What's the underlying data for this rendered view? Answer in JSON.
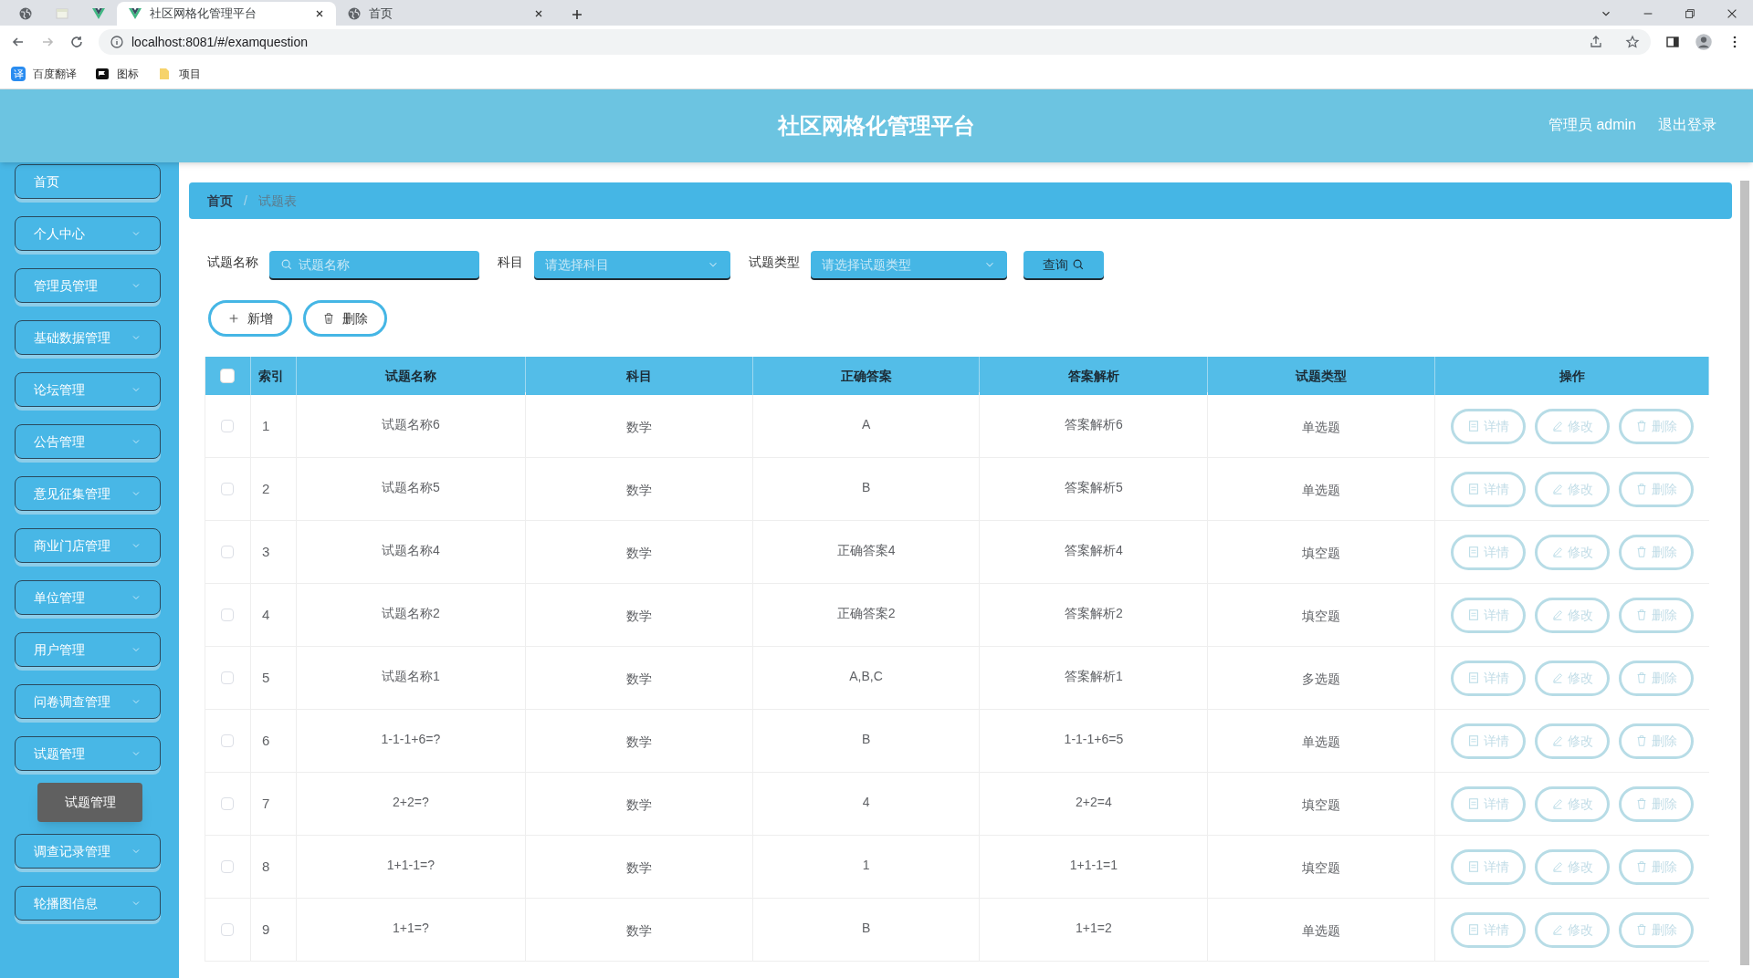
{
  "browser": {
    "tabs": [
      {
        "kind": "globe",
        "selected": false
      },
      {
        "kind": "page",
        "selected": false
      },
      {
        "kind": "vue",
        "selected": false
      },
      {
        "kind": "vue",
        "title": "社区网格化管理平台",
        "selected": true
      },
      {
        "kind": "globe",
        "title": "首页",
        "selected": false
      }
    ],
    "address": "localhost:8081/#/examquestion",
    "bookmarks": [
      {
        "kind": "translate",
        "badge": "译",
        "label": "百度翻译"
      },
      {
        "kind": "flag",
        "label": "图标"
      },
      {
        "kind": "folder",
        "label": "项目"
      }
    ]
  },
  "header": {
    "title": "社区网格化管理平台",
    "user": "管理员 admin",
    "logout": "退出登录"
  },
  "sidebar": {
    "items": [
      {
        "label": "首页",
        "expandable": false
      },
      {
        "label": "个人中心",
        "expandable": true
      },
      {
        "label": "管理员管理",
        "expandable": true
      },
      {
        "label": "基础数据管理",
        "expandable": true
      },
      {
        "label": "论坛管理",
        "expandable": true
      },
      {
        "label": "公告管理",
        "expandable": true
      },
      {
        "label": "意见征集管理",
        "expandable": true
      },
      {
        "label": "商业门店管理",
        "expandable": true
      },
      {
        "label": "单位管理",
        "expandable": true
      },
      {
        "label": "用户管理",
        "expandable": true
      },
      {
        "label": "问卷调查管理",
        "expandable": true
      },
      {
        "label": "试题管理",
        "expandable": true,
        "tooltip": "试题管理"
      },
      {
        "label": "调查记录管理",
        "expandable": true
      },
      {
        "label": "轮播图信息",
        "expandable": true
      }
    ]
  },
  "breadcrumb": [
    "首页",
    "试题表"
  ],
  "breadcrumb_separator": "/",
  "search": {
    "fields": [
      {
        "kind": "text",
        "label": "试题名称",
        "placeholder": "试题名称"
      },
      {
        "kind": "select",
        "label": "科目",
        "placeholder": "请选择科目"
      },
      {
        "kind": "select",
        "label": "试题类型",
        "placeholder": "请选择试题类型"
      }
    ],
    "button": "查询"
  },
  "actions": [
    {
      "kind": "add",
      "label": "新增"
    },
    {
      "kind": "delete",
      "label": "删除"
    }
  ],
  "table": {
    "select_all": false,
    "columns": [
      "索引",
      "试题名称",
      "科目",
      "正确答案",
      "答案解析",
      "试题类型",
      "操作"
    ],
    "rows": [
      {
        "checked": false,
        "cells": [
          "1",
          "试题名称6",
          "数学",
          "A",
          "答案解析6",
          "单选题"
        ],
        "ops": [
          "详情",
          "修改",
          "删除"
        ]
      },
      {
        "checked": false,
        "cells": [
          "2",
          "试题名称5",
          "数学",
          "B",
          "答案解析5",
          "单选题"
        ],
        "ops": [
          "详情",
          "修改",
          "删除"
        ]
      },
      {
        "checked": false,
        "cells": [
          "3",
          "试题名称4",
          "数学",
          "正确答案4",
          "答案解析4",
          "填空题"
        ],
        "ops": [
          "详情",
          "修改",
          "删除"
        ]
      },
      {
        "checked": false,
        "cells": [
          "4",
          "试题名称2",
          "数学",
          "正确答案2",
          "答案解析2",
          "填空题"
        ],
        "ops": [
          "详情",
          "修改",
          "删除"
        ]
      },
      {
        "checked": false,
        "cells": [
          "5",
          "试题名称1",
          "数学",
          "A,B,C",
          "答案解析1",
          "多选题"
        ],
        "ops": [
          "详情",
          "修改",
          "删除"
        ]
      },
      {
        "checked": false,
        "cells": [
          "6",
          "1-1-1+6=?",
          "数学",
          "B",
          "1-1-1+6=5",
          "单选题"
        ],
        "ops": [
          "详情",
          "修改",
          "删除"
        ]
      },
      {
        "checked": false,
        "cells": [
          "7",
          "2+2=?",
          "数学",
          "4",
          "2+2=4",
          "填空题"
        ],
        "ops": [
          "详情",
          "修改",
          "删除"
        ]
      },
      {
        "checked": false,
        "cells": [
          "8",
          "1+1-1=?",
          "数学",
          "1",
          "1+1-1=1",
          "填空题"
        ],
        "ops": [
          "详情",
          "修改",
          "删除"
        ]
      },
      {
        "checked": false,
        "cells": [
          "9",
          "1+1=?",
          "数学",
          "B",
          "1+1=2",
          "单选题"
        ],
        "ops": [
          "详情",
          "修改",
          "删除"
        ]
      }
    ]
  }
}
